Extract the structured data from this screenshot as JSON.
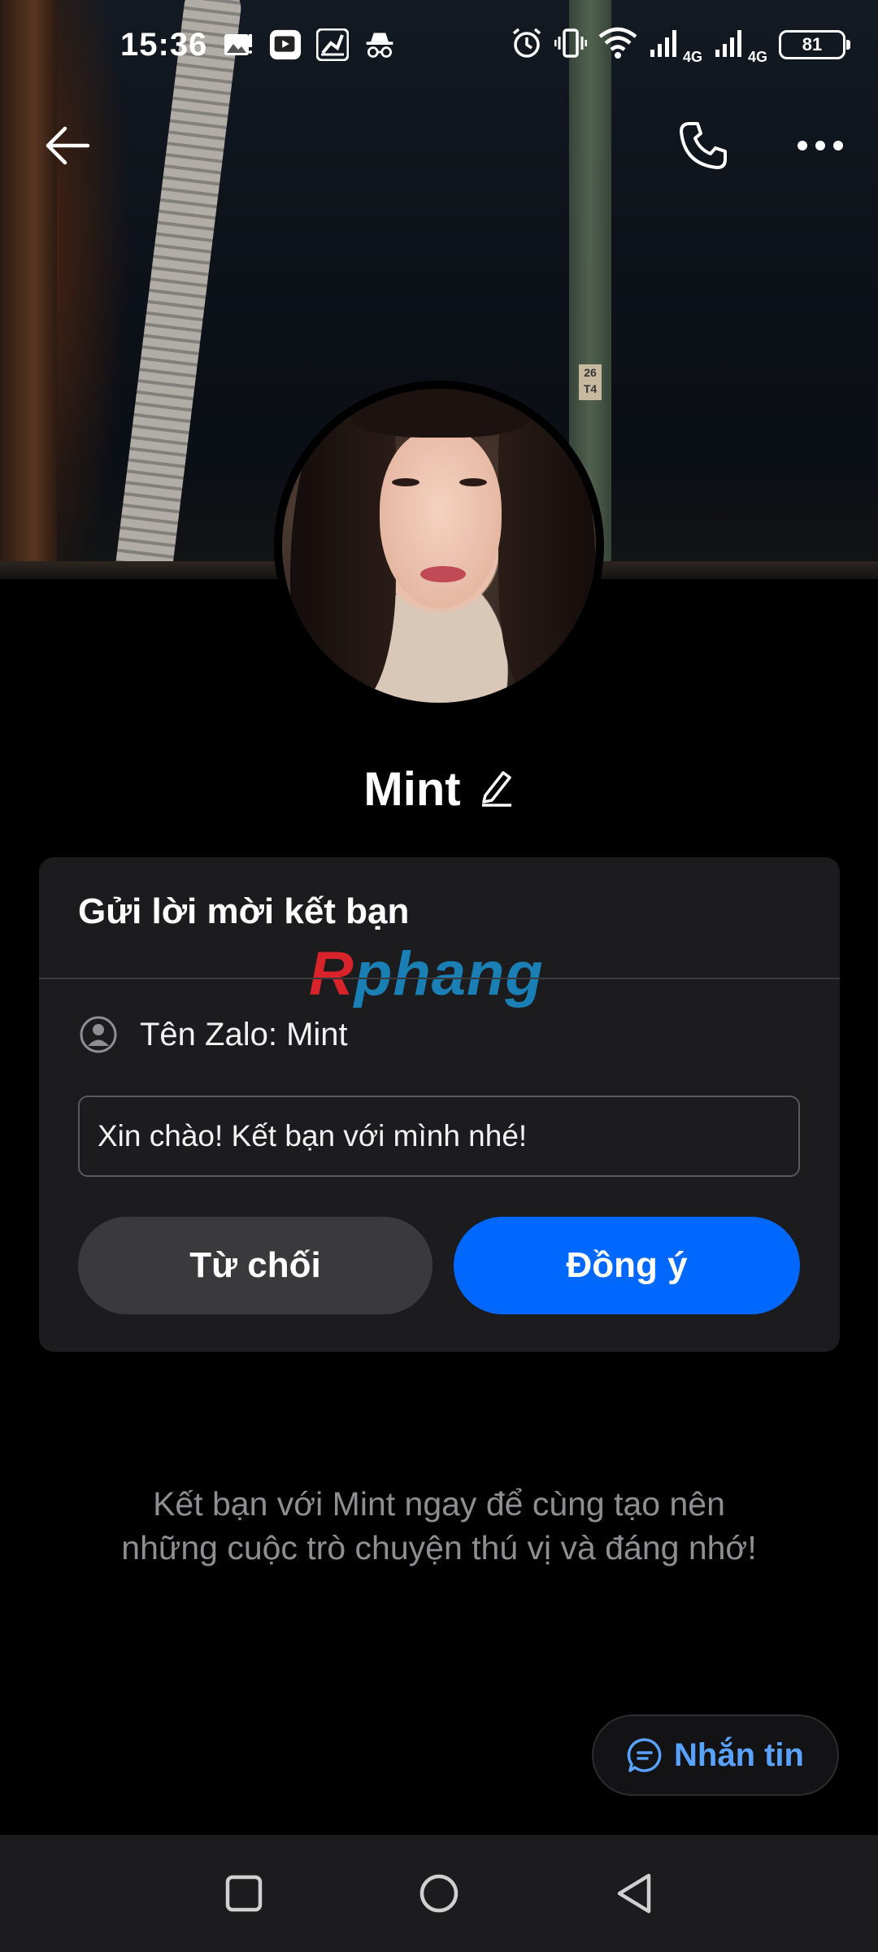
{
  "status_bar": {
    "time": "15:36",
    "battery_level": "81",
    "network_1": "4G",
    "network_2": "4G",
    "icons": [
      "gallery-icon",
      "video-app-icon",
      "clean-app-icon",
      "incognito-icon",
      "alarm-icon",
      "vibrate-icon",
      "wifi-icon",
      "signal-icon",
      "signal-icon",
      "battery-icon"
    ]
  },
  "header": {
    "back_icon": "arrow-left-icon",
    "call_icon": "phone-icon",
    "more_icon": "more-horizontal-icon"
  },
  "cover": {
    "sign_text": "26 T4"
  },
  "profile": {
    "name": "Mint",
    "edit_icon": "pencil-icon"
  },
  "friend_request": {
    "title": "Gửi lời mời kết bạn",
    "zalo_name_label": "Tên Zalo: Mint",
    "message": "Xin chào! Kết bạn với mình nhé!",
    "decline_label": "Từ chối",
    "accept_label": "Đồng ý"
  },
  "watermark": {
    "part1": "R",
    "part2": "phang"
  },
  "suggestion_text": "Kết bạn với Mint ngay để cùng tạo nên những cuộc trò chuyện thú vị và đáng nhớ!",
  "message_button": {
    "label": "Nhắn tin"
  },
  "colors": {
    "accent": "#0068ff",
    "card_bg": "#1c1c1e",
    "decline_bg": "#3a3a3c",
    "muted_text": "#8e8e93",
    "link_text": "#5aa2ff"
  }
}
